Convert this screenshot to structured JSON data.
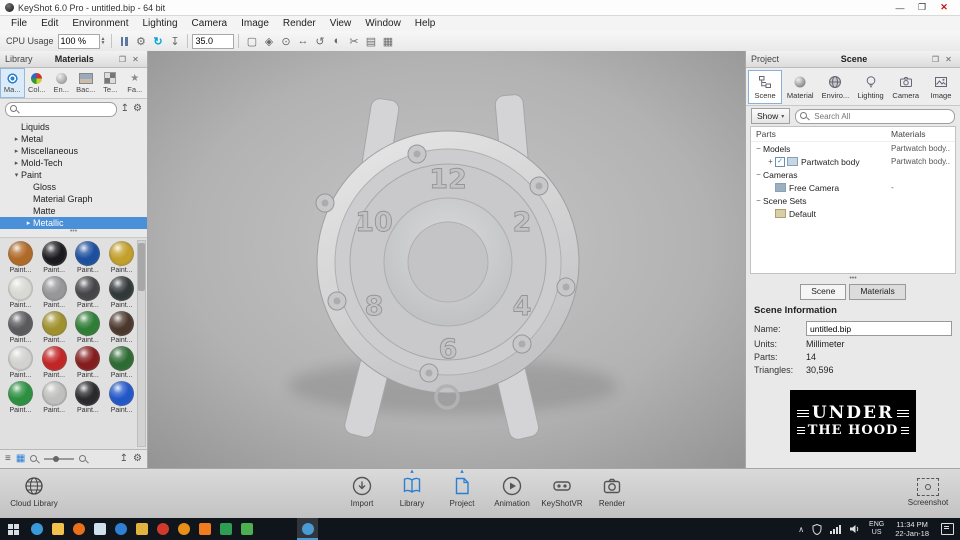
{
  "window": {
    "title": "KeyShot 6.0 Pro - untitled.bip - 64 bit",
    "minimize_glyph": "—",
    "maximize_glyph": "❐",
    "close_glyph": "✕"
  },
  "icons": {
    "float_glyph": "❐",
    "close_glyph": "✕",
    "caret_small": "▴",
    "caret_up": "∧",
    "gear": "⚙",
    "refresh": "↻",
    "download": "↧",
    "list": "≡",
    "grid": "▦",
    "flip_up": "↥",
    "star": "★",
    "region": "▢",
    "diamond": "◈",
    "target": "⊙",
    "pan": "↔",
    "orbit": "↺",
    "half": "◐",
    "cut": "✂",
    "sheet": "▤",
    "grid2": "▦"
  },
  "menubar": {
    "items": [
      "File",
      "Edit",
      "Environment",
      "Lighting",
      "Camera",
      "Image",
      "Render",
      "View",
      "Window",
      "Help"
    ]
  },
  "toolbar": {
    "cpu_label": "CPU Usage",
    "cpu_value": "100 %",
    "time_value": "35.0"
  },
  "library": {
    "panel_label": "Library",
    "panel_title": "Materials",
    "tabs": [
      {
        "label": "Ma..."
      },
      {
        "label": "Col..."
      },
      {
        "label": "En..."
      },
      {
        "label": "Bac..."
      },
      {
        "label": "Te..."
      },
      {
        "label": "Fa..."
      }
    ],
    "tree": [
      {
        "label": "Liquids",
        "arrow": ""
      },
      {
        "label": "Metal",
        "arrow": "▸"
      },
      {
        "label": "Miscellaneous",
        "arrow": "▸"
      },
      {
        "label": "Mold-Tech",
        "arrow": "▸"
      },
      {
        "label": "Paint",
        "arrow": "▾"
      },
      {
        "label": "Gloss",
        "arrow": ""
      },
      {
        "label": "Material Graph",
        "arrow": ""
      },
      {
        "label": "Matte",
        "arrow": ""
      },
      {
        "label": "Metallic",
        "arrow": "▸"
      }
    ],
    "splitter_dots": "•••",
    "swatches": [
      {
        "label": "Paint...",
        "color": "#b06a28"
      },
      {
        "label": "Paint...",
        "color": "#1b1b1f"
      },
      {
        "label": "Paint...",
        "color": "#1c4f9e"
      },
      {
        "label": "Paint...",
        "color": "#c3a02c"
      },
      {
        "label": "Paint...",
        "color": "#d9d9d4"
      },
      {
        "label": "Paint...",
        "color": "#97979a"
      },
      {
        "label": "Paint...",
        "color": "#46464a"
      },
      {
        "label": "Paint...",
        "color": "#32383a"
      },
      {
        "label": "Paint...",
        "color": "#5a5a5e"
      },
      {
        "label": "Paint...",
        "color": "#a1912e"
      },
      {
        "label": "Paint...",
        "color": "#2f7d36"
      },
      {
        "label": "Paint...",
        "color": "#4b382c"
      },
      {
        "label": "Paint...",
        "color": "#d2d2d0"
      },
      {
        "label": "Paint...",
        "color": "#c22525"
      },
      {
        "label": "Paint...",
        "color": "#841d1d"
      },
      {
        "label": "Paint...",
        "color": "#2e6b34"
      },
      {
        "label": "Paint...",
        "color": "#2c9040"
      },
      {
        "label": "Paint...",
        "color": "#bfbfbd"
      },
      {
        "label": "Paint...",
        "color": "#2a2a2e"
      },
      {
        "label": "Paint...",
        "color": "#2257c9"
      }
    ]
  },
  "viewport": {
    "numerals": [
      "12",
      "2",
      "4",
      "6",
      "8",
      "10"
    ]
  },
  "project": {
    "panel_label": "Project",
    "panel_title": "Scene",
    "ribbon": [
      {
        "label": "Scene"
      },
      {
        "label": "Material"
      },
      {
        "label": "Enviro..."
      },
      {
        "label": "Lighting"
      },
      {
        "label": "Camera"
      },
      {
        "label": "Image"
      }
    ],
    "show_label": "Show",
    "show_caret": "▾",
    "search_placeholder": "Search All",
    "columns": {
      "parts": "Parts",
      "materials": "Materials"
    },
    "tree": [
      {
        "expander": "−",
        "label": "Models",
        "material": "Partwatch body.."
      },
      {
        "expander": "+",
        "label": "Partwatch body",
        "material": "Partwatch body..",
        "checked": "✓"
      },
      {
        "expander": "−",
        "label": "Cameras",
        "material": ""
      },
      {
        "expander": "",
        "label": "Free Camera",
        "material": "-"
      },
      {
        "expander": "−",
        "label": "Scene Sets",
        "material": ""
      },
      {
        "expander": "",
        "label": "Default",
        "material": ""
      }
    ],
    "splitter_dots": "•••",
    "bottom_tabs": [
      {
        "label": "Scene"
      },
      {
        "label": "Materials"
      }
    ],
    "scene_info": {
      "heading": "Scene Information",
      "name_label": "Name:",
      "name_value": "untitled.bip",
      "units_label": "Units:",
      "units_value": "Millimeter",
      "parts_label": "Parts:",
      "parts_value": "14",
      "triangles_label": "Triangles:",
      "triangles_value": "30,596"
    },
    "logo": {
      "line1": "UNDER",
      "line2": "THE HOOD"
    }
  },
  "dock": {
    "cloud_label": "Cloud Library",
    "tools": [
      {
        "label": "Import"
      },
      {
        "label": "Library"
      },
      {
        "label": "Project"
      },
      {
        "label": "Animation"
      },
      {
        "label": "KeyShotVR"
      },
      {
        "label": "Render"
      }
    ],
    "screenshot_label": "Screenshot"
  },
  "taskbar": {
    "icons": [
      {
        "name": "cortana-search-icon",
        "color": "#3a9ad9",
        "shape": "circle"
      },
      {
        "name": "file-explorer-icon",
        "color": "#f2c14b",
        "shape": "square"
      },
      {
        "name": "firefox-icon",
        "color": "#e8701a",
        "shape": "circle"
      },
      {
        "name": "mail-icon",
        "color": "#cfe0ef",
        "shape": "square"
      },
      {
        "name": "edge-browser-icon",
        "color": "#2f80d4",
        "shape": "circle"
      },
      {
        "name": "folder-icon",
        "color": "#e2b23f",
        "shape": "square"
      },
      {
        "name": "opera-icon",
        "color": "#d03a2a",
        "shape": "circle"
      },
      {
        "name": "vlc-icon",
        "color": "#e88f1a",
        "shape": "circle"
      },
      {
        "name": "illustrator-icon",
        "color": "#f07c1e",
        "shape": "square"
      },
      {
        "name": "excel-icon",
        "color": "#2e9e53",
        "shape": "square"
      },
      {
        "name": "green-app-icon",
        "color": "#4caf50",
        "shape": "square"
      },
      {
        "name": "keyshot-taskbar-icon",
        "color": "#4a9ad4",
        "shape": "circle",
        "active": true
      }
    ],
    "lang_primary": "ENG",
    "lang_secondary": "US",
    "time": "11:34 PM",
    "date": "22-Jan-18"
  }
}
